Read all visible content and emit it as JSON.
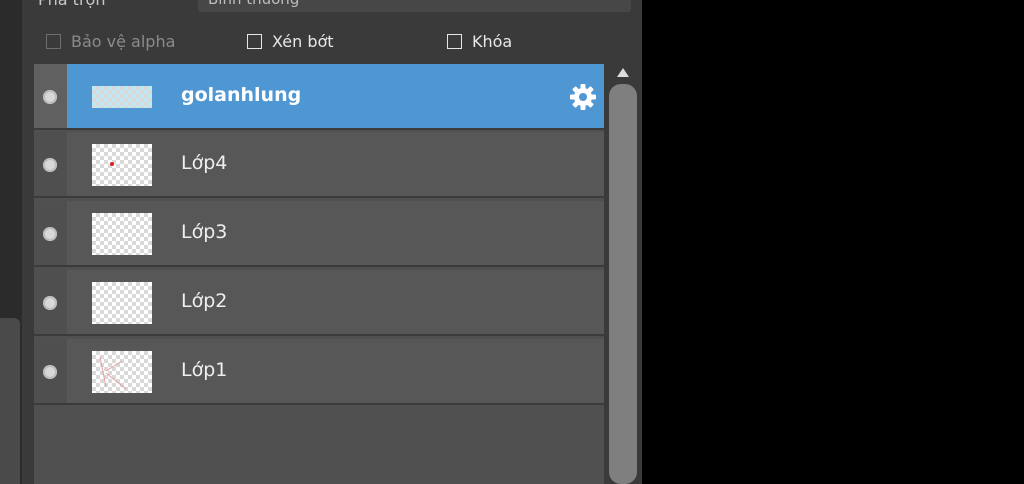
{
  "blend": {
    "label": "Pha trộn",
    "value": "Bình thường"
  },
  "options": {
    "protect_alpha": "Bảo vệ alpha",
    "clip": "Xén bớt",
    "lock": "Khóa"
  },
  "layers": [
    {
      "name": "golanhlung",
      "selected": true
    },
    {
      "name": "Lớp4",
      "selected": false
    },
    {
      "name": "Lớp3",
      "selected": false
    },
    {
      "name": "Lớp2",
      "selected": false
    },
    {
      "name": "Lớp1",
      "selected": false
    }
  ],
  "colors": {
    "selected_row": "#4f97d3",
    "row_bg": "#575757",
    "panel_bg": "#3a3a3a"
  },
  "icons": {
    "layer_settings": "gear-icon",
    "visibility": "visibility-dot-icon",
    "scroll_up": "scroll-up-arrow-icon"
  }
}
